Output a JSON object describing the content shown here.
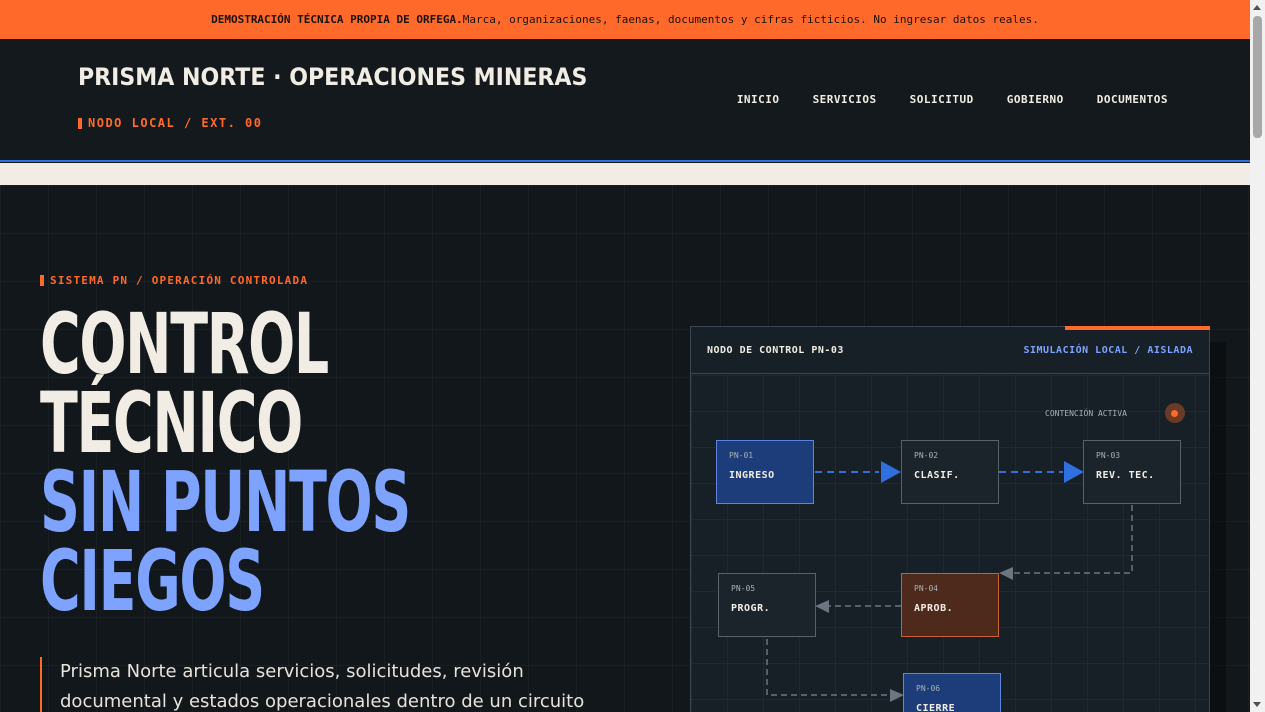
{
  "banner": {
    "bold_text": "DEMOSTRACIÓN TÉCNICA PROPIA DE ORFEGA.",
    "text": " Marca, organizaciones, faenas, documentos y cifras ficticios. No ingresar datos reales."
  },
  "header": {
    "brand": "PRISMA NORTE · OPERACIONES MINERAS",
    "node": "NODO LOCAL / EXT. 00",
    "nav": [
      "INICIO",
      "SERVICIOS",
      "SOLICITUD",
      "GOBIERNO",
      "DOCUMENTOS"
    ]
  },
  "hero": {
    "eyebrow": "SISTEMA PN / OPERACIÓN CONTROLADA",
    "headline": [
      "CONTROL",
      "TÉCNICO",
      "SIN PUNTOS",
      "CIEGOS"
    ],
    "lede": "Prisma Norte articula servicios, solicitudes, revisión documental y estados operacionales dentro de un circuito aislado y verificable."
  },
  "panel": {
    "title": "NODO DE CONTROL PN-03",
    "mode": "SIMULACIÓN LOCAL / AISLADA",
    "status": "CONTENCIÓN ACTIVA",
    "stages": [
      {
        "code": "PN-01",
        "label": "INGRESO",
        "state": "blue"
      },
      {
        "code": "PN-02",
        "label": "CLASIF.",
        "state": "default"
      },
      {
        "code": "PN-03",
        "label": "REV. TEC.",
        "state": "default"
      },
      {
        "code": "PN-04",
        "label": "APROB.",
        "state": "orange"
      },
      {
        "code": "PN-05",
        "label": "PROGR.",
        "state": "default"
      },
      {
        "code": "PN-06",
        "label": "CIERRE",
        "state": "blue"
      }
    ],
    "colors": {
      "active": "#1d3d7a",
      "accent": "#ff6a2b",
      "link": "#2f6fe0"
    }
  }
}
